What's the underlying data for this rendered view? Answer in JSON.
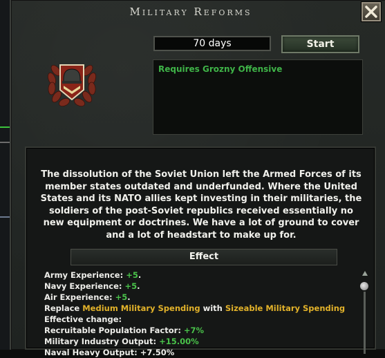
{
  "window": {
    "title": "Military Reforms"
  },
  "focus": {
    "duration": "70 days",
    "start_label": "Start",
    "requirement": "Requires Grozny Offensive",
    "icon": "helmet-laurel-icon"
  },
  "description": "The dissolution of the Soviet Union left the Armed Forces of its member states outdated and underfunded. Where the United States and its NATO allies kept investing in their militaries, the soldiers of the post-Soviet republics received essentially no new equipment or doctrines. We have a lot of ground to cover and a lot of headstart to make up for.",
  "effect": {
    "header": "Effect",
    "army_label": "Army Experience: ",
    "army_value": "+5",
    "navy_label": "Navy Experience: ",
    "navy_value": "+5",
    "air_label": "Air Experience: ",
    "air_value": "+5",
    "replace_prefix": "Replace ",
    "replace_from": "Medium Military Spending",
    "replace_mid": " with ",
    "replace_to": "Sizeable Military Spending",
    "effective_change": "Effective change:",
    "recruit_label": "Recruitable Population Factor: ",
    "recruit_value": "+7%",
    "industry_label": "Military Industry Output: ",
    "industry_value": "+15.00%",
    "partial_line": "Naval Heavy Output: +7.50%"
  },
  "colors": {
    "positive": "#49c24a",
    "highlight": "#e2b22a",
    "requirement": "#3fb448"
  }
}
